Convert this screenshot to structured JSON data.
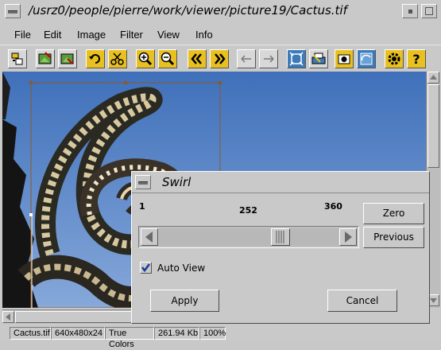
{
  "window": {
    "title": "/usrz0/people/pierre/work/viewer/picture19/Cactus.tif"
  },
  "menubar": {
    "items": [
      {
        "label": "File",
        "mnemonic": "F"
      },
      {
        "label": "Edit",
        "mnemonic": "E"
      },
      {
        "label": "Image",
        "mnemonic": "I"
      },
      {
        "label": "Filter",
        "mnemonic": "F"
      },
      {
        "label": "View",
        "mnemonic": "V"
      },
      {
        "label": "Info",
        "mnemonic": "I"
      }
    ]
  },
  "toolbar": {
    "icons": [
      "open-icon",
      "load-image-icon",
      "save-image-icon",
      "undo-icon",
      "cut-icon",
      "zoom-in-icon",
      "zoom-out-icon",
      "first-image-icon",
      "last-image-icon",
      "previous-icon",
      "next-icon",
      "fit-window-icon",
      "print-icon",
      "snapshot-icon",
      "refresh-icon",
      "settings-icon",
      "help-icon"
    ]
  },
  "dialog": {
    "title": "Swirl",
    "min_label": "1",
    "max_label": "360",
    "value_label": "252",
    "slider_value": 252,
    "slider_min": 1,
    "slider_max": 360,
    "zero_button": "Zero",
    "previous_button": "Previous",
    "auto_view_label": "Auto View",
    "auto_view_checked": true,
    "apply_button": "Apply",
    "cancel_button": "Cancel"
  },
  "statusbar": {
    "filename": "Cactus.tif",
    "dimensions": "640x480x24",
    "color_mode": "True Colors",
    "size": "261.94 Kb",
    "zoom": "100%"
  },
  "colors": {
    "chrome": "#c9c9c9",
    "accent_yellow": "#e8c020",
    "sky_blue": "#5a88cc"
  }
}
